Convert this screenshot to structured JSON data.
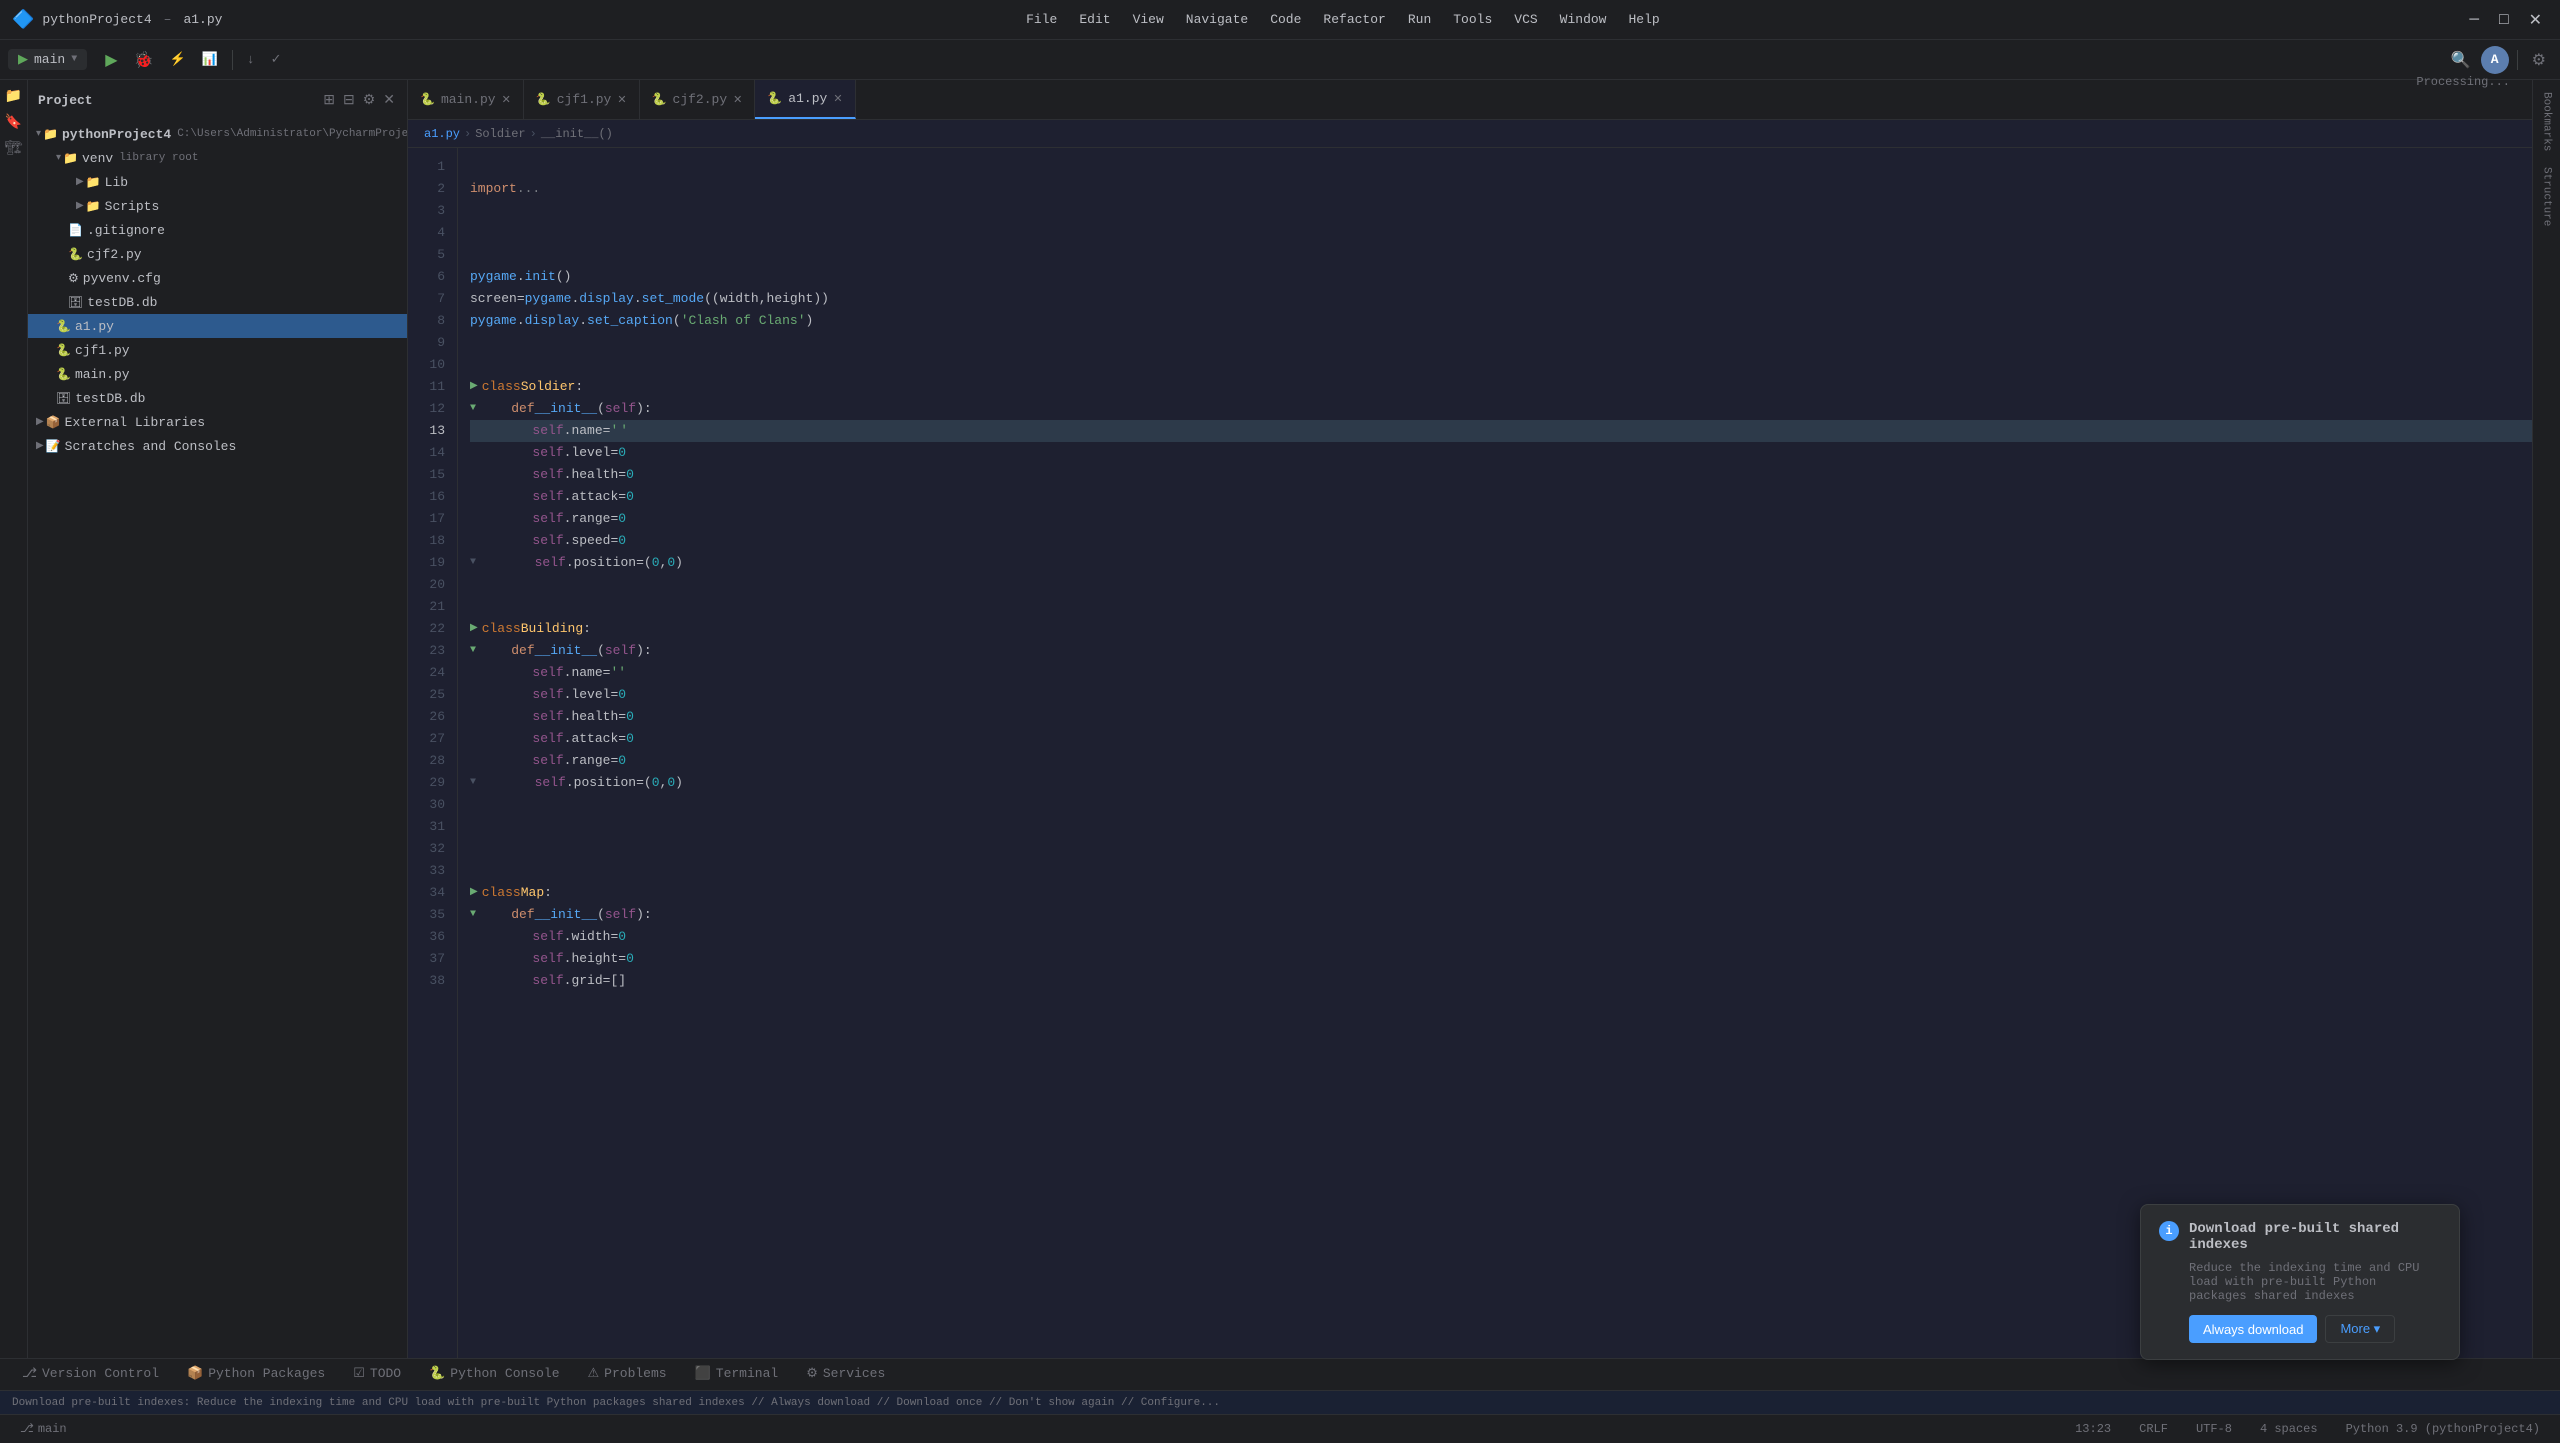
{
  "window": {
    "title": "pythonProject4 – a1.py"
  },
  "menu": {
    "items": [
      "File",
      "Edit",
      "View",
      "Navigate",
      "Code",
      "Refactor",
      "Run",
      "Tools",
      "VCS",
      "Window",
      "Help"
    ]
  },
  "project": {
    "name": "pythonProject4",
    "path": "C:\\Users\\Administrator\\PycharmProjects\\python"
  },
  "toolbar": {
    "run_config": "main",
    "processing": "Processing..."
  },
  "tabs": [
    {
      "label": "main.py",
      "icon": "🐍",
      "active": false,
      "closeable": true
    },
    {
      "label": "cjf1.py",
      "icon": "🐍",
      "active": false,
      "closeable": true
    },
    {
      "label": "cjf2.py",
      "icon": "🐍",
      "active": false,
      "closeable": true
    },
    {
      "label": "a1.py",
      "icon": "🐍",
      "active": true,
      "closeable": true
    }
  ],
  "breadcrumb": {
    "parts": [
      "Soldier",
      "__init__()"
    ]
  },
  "code": {
    "lines": [
      {
        "num": 1,
        "content": ""
      },
      {
        "num": 2,
        "text": "import ...",
        "type": "import"
      },
      {
        "num": 3,
        "content": ""
      },
      {
        "num": 4,
        "content": ""
      },
      {
        "num": 5,
        "content": ""
      },
      {
        "num": 6,
        "text": "pygame.init()"
      },
      {
        "num": 7,
        "text": "screen = pygame.display.set_mode((width, height))"
      },
      {
        "num": 8,
        "text": "pygame.display.set_caption('Clash of Clans')"
      },
      {
        "num": 9,
        "content": ""
      },
      {
        "num": 10,
        "content": ""
      },
      {
        "num": 11,
        "text": "class Soldier:",
        "type": "class"
      },
      {
        "num": 12,
        "text": "    def __init__(self):",
        "type": "def",
        "fold": true
      },
      {
        "num": 13,
        "text": "        self.name = '|'",
        "cursor": true
      },
      {
        "num": 14,
        "text": "        self.level = 0"
      },
      {
        "num": 15,
        "text": "        self.health = 0"
      },
      {
        "num": 16,
        "text": "        self.attack = 0"
      },
      {
        "num": 17,
        "text": "        self.range = 0"
      },
      {
        "num": 18,
        "text": "        self.speed = 0"
      },
      {
        "num": 19,
        "text": "        self.position = (0, 0)",
        "fold": true
      },
      {
        "num": 20,
        "content": ""
      },
      {
        "num": 21,
        "content": ""
      },
      {
        "num": 22,
        "text": "class Building:",
        "type": "class"
      },
      {
        "num": 23,
        "text": "    def __init__(self):",
        "type": "def",
        "fold": true
      },
      {
        "num": 24,
        "text": "        self.name = ''"
      },
      {
        "num": 25,
        "text": "        self.level = 0"
      },
      {
        "num": 26,
        "text": "        self.health = 0"
      },
      {
        "num": 27,
        "text": "        self.attack = 0"
      },
      {
        "num": 28,
        "text": "        self.range = 0"
      },
      {
        "num": 29,
        "text": "        self.position = (0, 0)",
        "fold": true
      },
      {
        "num": 30,
        "content": ""
      },
      {
        "num": 31,
        "content": ""
      },
      {
        "num": 32,
        "content": ""
      },
      {
        "num": 33,
        "content": ""
      },
      {
        "num": 34,
        "text": "class Map:",
        "type": "class"
      },
      {
        "num": 35,
        "text": "    def __init__(self):",
        "type": "def",
        "fold": true
      },
      {
        "num": 36,
        "text": "        self.width = 0"
      },
      {
        "num": 37,
        "text": "        self.height = 0"
      },
      {
        "num": 38,
        "text": "        self.grid = []"
      }
    ]
  },
  "sidebar": {
    "project_label": "Project",
    "tree": [
      {
        "indent": 0,
        "type": "folder",
        "label": "pythonProject4",
        "open": true,
        "bold": true
      },
      {
        "indent": 1,
        "type": "folder",
        "label": "venv",
        "open": true,
        "extra": "library root"
      },
      {
        "indent": 2,
        "type": "folder",
        "label": "Lib",
        "open": false
      },
      {
        "indent": 2,
        "type": "folder",
        "label": "Scripts",
        "open": false
      },
      {
        "indent": 1,
        "type": "file",
        "label": ".gitignore",
        "icon": "📄"
      },
      {
        "indent": 1,
        "type": "file",
        "label": "cjf2.py",
        "icon": "🐍"
      },
      {
        "indent": 1,
        "type": "file",
        "label": "pyvenv.cfg",
        "icon": "⚙"
      },
      {
        "indent": 1,
        "type": "file",
        "label": "testDB.db",
        "icon": "🗄"
      },
      {
        "indent": 0,
        "type": "file",
        "label": "a1.py",
        "icon": "🐍",
        "selected": true
      },
      {
        "indent": 0,
        "type": "file",
        "label": "cjf1.py",
        "icon": "🐍"
      },
      {
        "indent": 0,
        "type": "file",
        "label": "main.py",
        "icon": "🐍"
      },
      {
        "indent": 0,
        "type": "file",
        "label": "testDB.db",
        "icon": "🗄"
      },
      {
        "indent": 0,
        "type": "folder",
        "label": "External Libraries",
        "open": false
      },
      {
        "indent": 0,
        "type": "folder",
        "label": "Scratches and Consoles",
        "open": false
      }
    ]
  },
  "notification": {
    "title": "Download pre-built shared indexes",
    "description": "Reduce the indexing time and CPU load with pre-built Python packages shared indexes",
    "btn_primary": "Always download",
    "btn_secondary": "More ▾"
  },
  "status_bar": {
    "info": "Download pre-built indexes: Reduce the indexing time and CPU load with pre-built Python packages shared indexes // Always download // Download once // Don't show again // Configure...",
    "position": "13:23",
    "encoding": "CRLF",
    "charset": "UTF-8",
    "indent": "4 spaces",
    "python": "Python 3.9 (pythonProject4)"
  },
  "bottom_tabs": [
    {
      "label": "Version Control",
      "icon": "⎇"
    },
    {
      "label": "Python Packages",
      "icon": "📦"
    },
    {
      "label": "TODO",
      "icon": "☑"
    },
    {
      "label": "Python Console",
      "icon": "🐍"
    },
    {
      "label": "Problems",
      "icon": "⚠"
    },
    {
      "label": "Terminal",
      "icon": "⬛"
    },
    {
      "label": "Services",
      "icon": "⚙"
    }
  ]
}
